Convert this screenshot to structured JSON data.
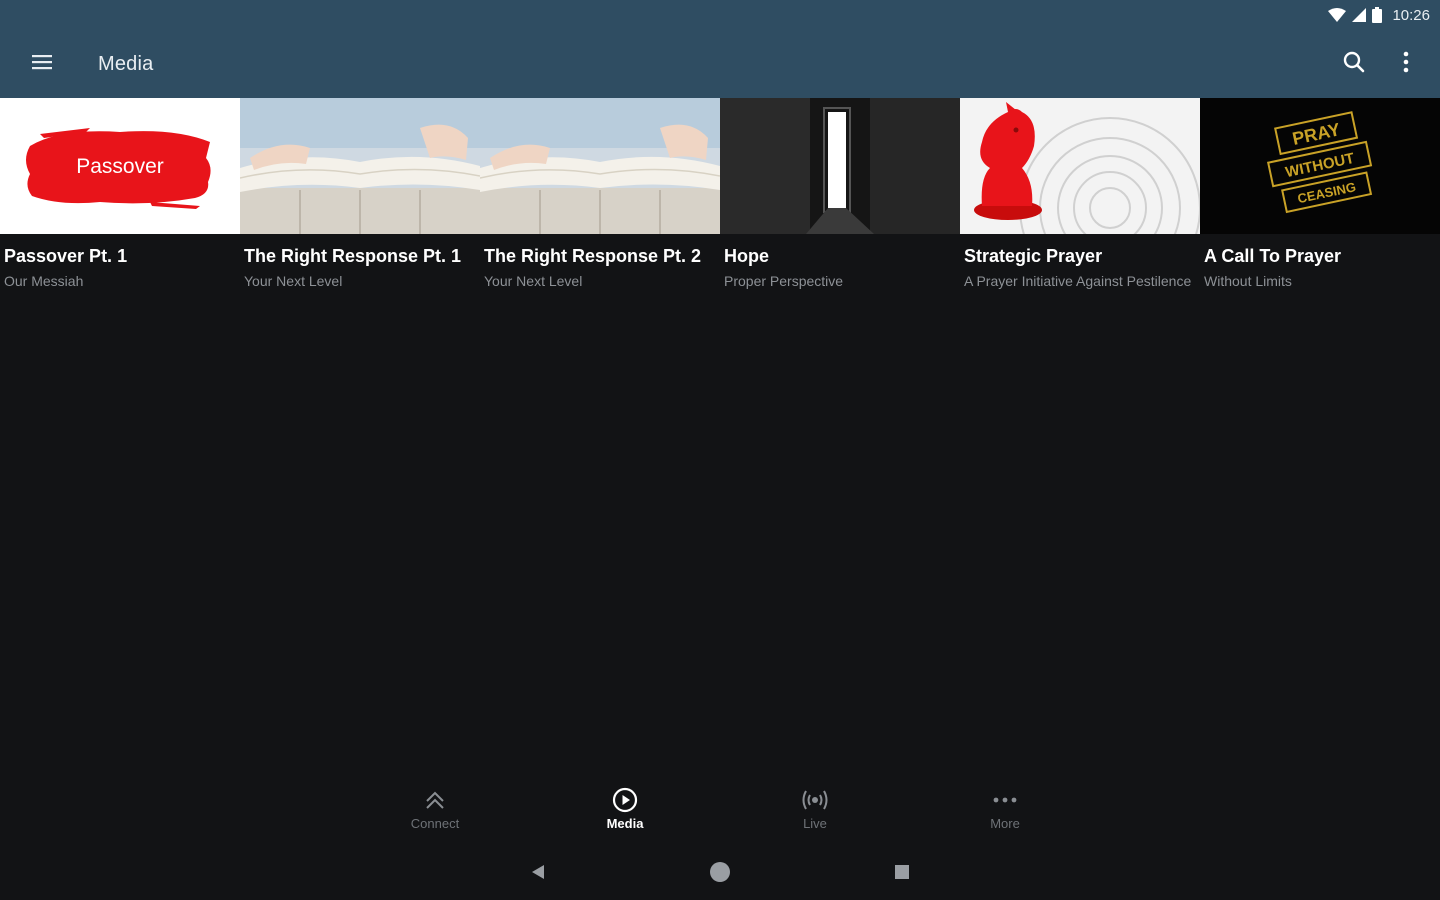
{
  "status_bar": {
    "time": "10:26"
  },
  "app_bar": {
    "title": "Media"
  },
  "media_items": [
    {
      "title": "Passover Pt. 1",
      "subtitle": "Our Messiah",
      "thumb_text": "Passover"
    },
    {
      "title": "The Right Response Pt. 1",
      "subtitle": "Your Next Level"
    },
    {
      "title": "The Right Response Pt. 2",
      "subtitle": "Your Next Level"
    },
    {
      "title": "Hope",
      "subtitle": "Proper Perspective"
    },
    {
      "title": "Strategic Prayer",
      "subtitle": "A Prayer Initiative Against Pestilence"
    },
    {
      "title": "A Call To Prayer",
      "subtitle": "Without Limits",
      "thumb_lines": [
        "PRAY",
        "WITHOUT",
        "CEASING"
      ]
    }
  ],
  "bottom_nav": {
    "items": [
      {
        "label": "Connect",
        "icon": "double-chevron-up-icon"
      },
      {
        "label": "Media",
        "icon": "play-circle-icon",
        "active": true
      },
      {
        "label": "Live",
        "icon": "broadcast-icon"
      },
      {
        "label": "More",
        "icon": "more-horizontal-icon"
      }
    ]
  },
  "colors": {
    "app_bar": "#2f4d62",
    "background": "#121315",
    "accent_red": "#e8141a",
    "subtitle_gray": "#8d9196"
  }
}
